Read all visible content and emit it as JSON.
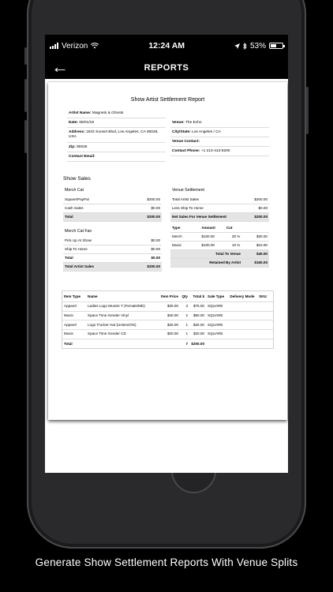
{
  "status_bar": {
    "carrier": "Verizon",
    "time": "12:24 AM",
    "battery": "53%",
    "battery_level": 0.53
  },
  "nav": {
    "back_icon": "arrow-left-icon",
    "title": "REPORTS"
  },
  "report": {
    "title": "Show Artist Settlement Report",
    "artist_name_label": "Artist Name:",
    "artist_name": "Magnets & Ghosts",
    "date_label": "Date:",
    "date": "06/01/18",
    "address_label": "Address:",
    "address_line1": "1822 Sunset Blvd, Los Angeles, CA 90026,",
    "address_line2": "USA",
    "zip_label": "Zip:",
    "zip": "90026",
    "contact_email_label": "Contact Email:",
    "contact_email": "",
    "venue_label": "Venue:",
    "venue": "The Echo",
    "city_state_label": "City/State:",
    "city_state": "Los Angeles / CA",
    "venue_contact_label": "Venue Contact:",
    "venue_contact": "",
    "contact_phone_label": "Contact Phone:",
    "contact_phone": "+1 213-413-8200",
    "show_sales_title": "Show Sales",
    "merch_cat": {
      "title": "Merch Cat",
      "rows": [
        {
          "label": "Square/PayPal",
          "value": "$200.00"
        },
        {
          "label": "Cash Sales",
          "value": "$0.00"
        }
      ],
      "total_label": "Total",
      "total_value": "$200.00"
    },
    "merch_cat_fan": {
      "title": "Merch Cat Fan",
      "rows": [
        {
          "label": "Pick Up At Show",
          "value": "$0.00"
        },
        {
          "label": "Ship To Home",
          "value": "$0.00"
        }
      ],
      "total_label": "Total",
      "total_value": "$0.00",
      "artist_total_label": "Total Artist Sales",
      "artist_total_value": "$200.00"
    },
    "venue_settlement": {
      "title": "Venue Settlement",
      "rows": [
        {
          "label": "Total Artist Sales",
          "value": "$200.00"
        },
        {
          "label": "Less Ship To Home",
          "value": "$0.00"
        }
      ],
      "net_label": "Net Sales For Venue Settlement",
      "net_value": "$200.00",
      "headers": {
        "type": "Type",
        "amount": "Amount",
        "cut": "Cut"
      },
      "splits": [
        {
          "type": "Merch",
          "amount": "$100.00",
          "pct": "30 %",
          "cut": "$30.00"
        },
        {
          "type": "Music",
          "amount": "$100.00",
          "pct": "10 %",
          "cut": "$10.00"
        }
      ],
      "to_venue_label": "Total To Venue",
      "to_venue_value": "$40.00",
      "retained_label": "Retained By Artist",
      "retained_value": "$160.00"
    },
    "items": {
      "headers": [
        "Item Type",
        "Name",
        "Item Price",
        "Qty",
        "Total $",
        "Sale Type",
        "Delivery Mode",
        "SKU"
      ],
      "rows": [
        [
          "Apparel",
          "Ladies Logo Muscle T (Female/MD)",
          "$25.00",
          "3",
          "$75.00",
          "SQUARE",
          "",
          ""
        ],
        [
          "Music",
          "Space Time Gender Vinyl",
          "$40.00",
          "2",
          "$80.00",
          "SQUARE",
          "",
          ""
        ],
        [
          "Apparel",
          "Logo Trucker Hat (Unisex/OS)",
          "$25.00",
          "1",
          "$25.00",
          "SQUARE",
          "",
          ""
        ],
        [
          "Music",
          "Space Time Gender CD",
          "$20.00",
          "1",
          "$20.00",
          "SQUARE",
          "",
          ""
        ],
        [
          "Total",
          "",
          "",
          "7",
          "$200.00",
          "",
          "",
          ""
        ]
      ]
    }
  },
  "caption": "Generate Show Settlement Reports With Venue Splits"
}
